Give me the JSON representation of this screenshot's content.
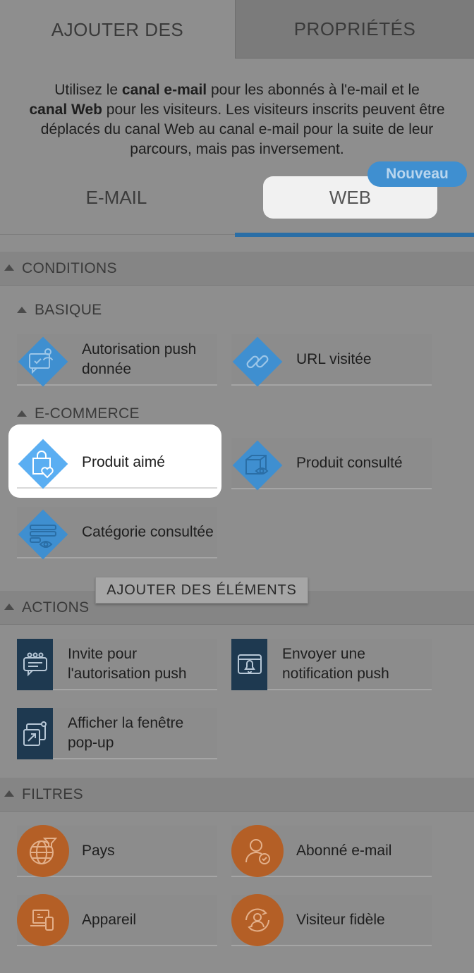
{
  "top_tabs": {
    "add": "AJOUTER DES",
    "properties": "PROPRIÉTÉS"
  },
  "intro": {
    "p1": "Utilisez le ",
    "b1": "canal e-mail",
    "p2": " pour les abonnés à l'e-mail et le ",
    "b2": "canal Web",
    "p3": " pour les visiteurs. Les visiteurs inscrits peuvent être déplacés du canal Web au canal e-mail pour la suite de leur parcours, mais pas inversement."
  },
  "channels": {
    "email": "E-MAIL",
    "web": "WEB",
    "new_badge": "Nouveau"
  },
  "sections": {
    "conditions": "CONDITIONS",
    "basique": "BASIQUE",
    "ecommerce": "E-COMMERCE",
    "actions": "ACTIONS",
    "filtres": "FILTRES"
  },
  "conditions_basique": [
    {
      "label": "Autorisation push donnée",
      "icon": "push-permission-icon"
    },
    {
      "label": "URL visitée",
      "icon": "link-icon"
    }
  ],
  "conditions_ecommerce": [
    {
      "label": "Produit aimé",
      "icon": "liked-product-icon"
    },
    {
      "label": "Produit consulté",
      "icon": "viewed-product-icon"
    },
    {
      "label": "Catégorie consultée",
      "icon": "viewed-category-icon"
    }
  ],
  "actions": [
    {
      "label": "Invite pour l'autorisation push",
      "icon": "push-invite-icon"
    },
    {
      "label": "Envoyer une notification push",
      "icon": "notification-bell-icon"
    },
    {
      "label": "Afficher la fenêtre pop-up",
      "icon": "popup-window-icon"
    }
  ],
  "filtres": [
    {
      "label": "Pays",
      "icon": "globe-icon"
    },
    {
      "label": "Abonné e-mail",
      "icon": "email-subscriber-icon"
    },
    {
      "label": "Appareil",
      "icon": "device-icon"
    },
    {
      "label": "Visiteur fidèle",
      "icon": "loyal-visitor-icon"
    }
  ],
  "tooltip": "AJOUTER DES ÉLÉMENTS",
  "colors": {
    "background": "#8e8e8e",
    "condition_blue": "#3f8fd0",
    "condition_blue_highlight": "#5aaef2",
    "action_navy": "#1e3950",
    "filter_orange": "#b45f26",
    "accent_underline": "#2a6ea6"
  }
}
